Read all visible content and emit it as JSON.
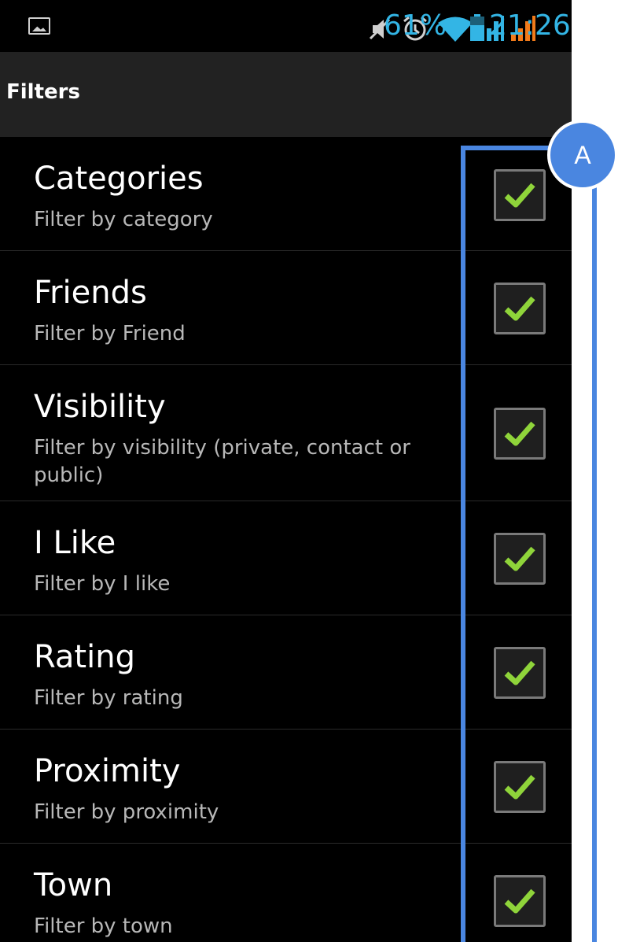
{
  "status_bar": {
    "battery_percent": "61%",
    "time": "21:26",
    "icons": [
      "image-notification-icon",
      "muted-icon",
      "alarm-icon",
      "wifi-icon",
      "signal-icon",
      "signal-roaming-icon",
      "battery-icon"
    ]
  },
  "action_bar": {
    "title": "Filters"
  },
  "filters": [
    {
      "title": "Categories",
      "subtitle": "Filter by category",
      "checked": true
    },
    {
      "title": "Friends",
      "subtitle": "Filter by Friend",
      "checked": true
    },
    {
      "title": "Visibility",
      "subtitle": "Filter by visibility (private, contact or public)",
      "checked": true
    },
    {
      "title": "I Like",
      "subtitle": "Filter by I like",
      "checked": true
    },
    {
      "title": "Rating",
      "subtitle": "Filter by rating",
      "checked": true
    },
    {
      "title": "Proximity",
      "subtitle": "Filter by proximity",
      "checked": true
    },
    {
      "title": "Town",
      "subtitle": "Filter by town",
      "checked": true
    }
  ],
  "annotation": {
    "label": "A"
  },
  "colors": {
    "accent": "#33b5e5",
    "signal_alt": "#f07a1a",
    "check": "#8fd43a",
    "annotation": "#4a86e0"
  }
}
